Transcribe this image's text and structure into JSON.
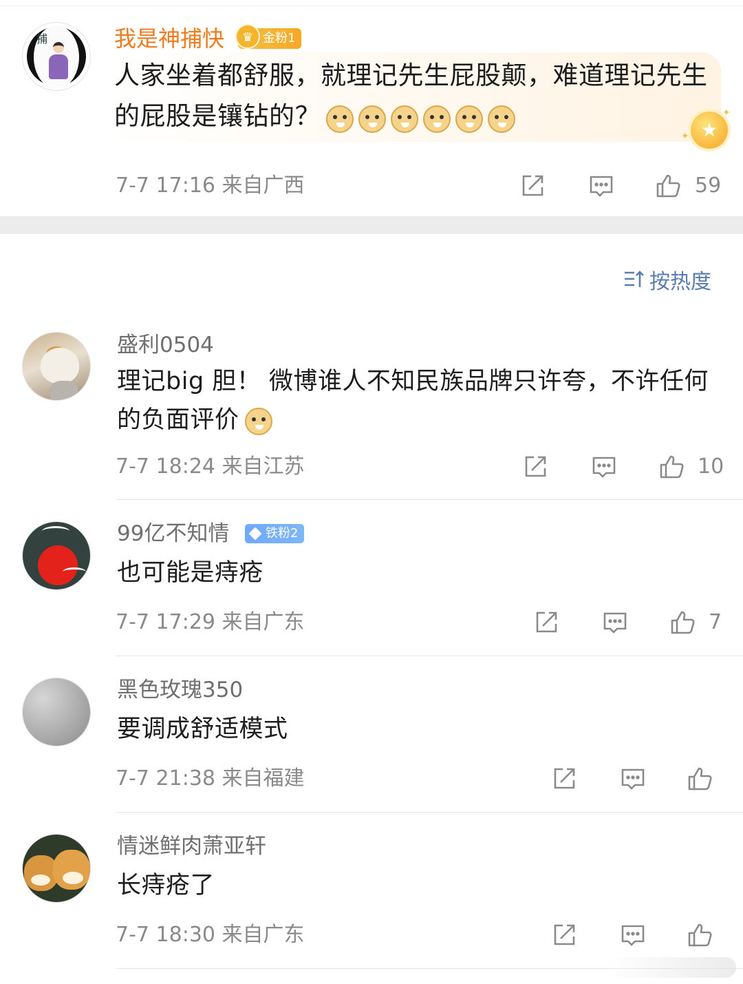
{
  "featured": {
    "username": "我是神捕快",
    "badge": "金粉1",
    "text": "人家坐着都舒服，就理记先生屁股颠，难道理记先生的屁股是镶钻的？",
    "emoji_count": 6,
    "time": "7-7 17:16",
    "location": "来自广西",
    "likes": "59"
  },
  "sort": {
    "label": "按热度"
  },
  "comments": [
    {
      "username": "盛利0504",
      "badge": "",
      "text": "理记big 胆！ 微博谁人不知民族品牌只许夸，不许任何的负面评价",
      "time": "7-7 18:24",
      "location": "来自江苏",
      "likes": "10"
    },
    {
      "username": "99亿不知情",
      "badge": "铁粉2",
      "text": "也可能是痔疮",
      "time": "7-7 17:29",
      "location": "来自广东",
      "likes": "7"
    },
    {
      "username": "黑色玫瑰350",
      "badge": "",
      "text": "要调成舒适模式",
      "time": "7-7 21:38",
      "location": "来自福建",
      "likes": ""
    },
    {
      "username": "情迷鲜肉萧亚轩",
      "badge": "",
      "text": "长痔疮了",
      "time": "7-7 18:30",
      "location": "来自广东",
      "likes": ""
    }
  ],
  "colors": {
    "gold_name": "#f07a1e",
    "sort_blue": "#5a7bb0",
    "meta_grey": "#8a8a8a"
  },
  "icons": [
    "share-icon",
    "comment-icon",
    "like-icon",
    "sort-icon"
  ]
}
